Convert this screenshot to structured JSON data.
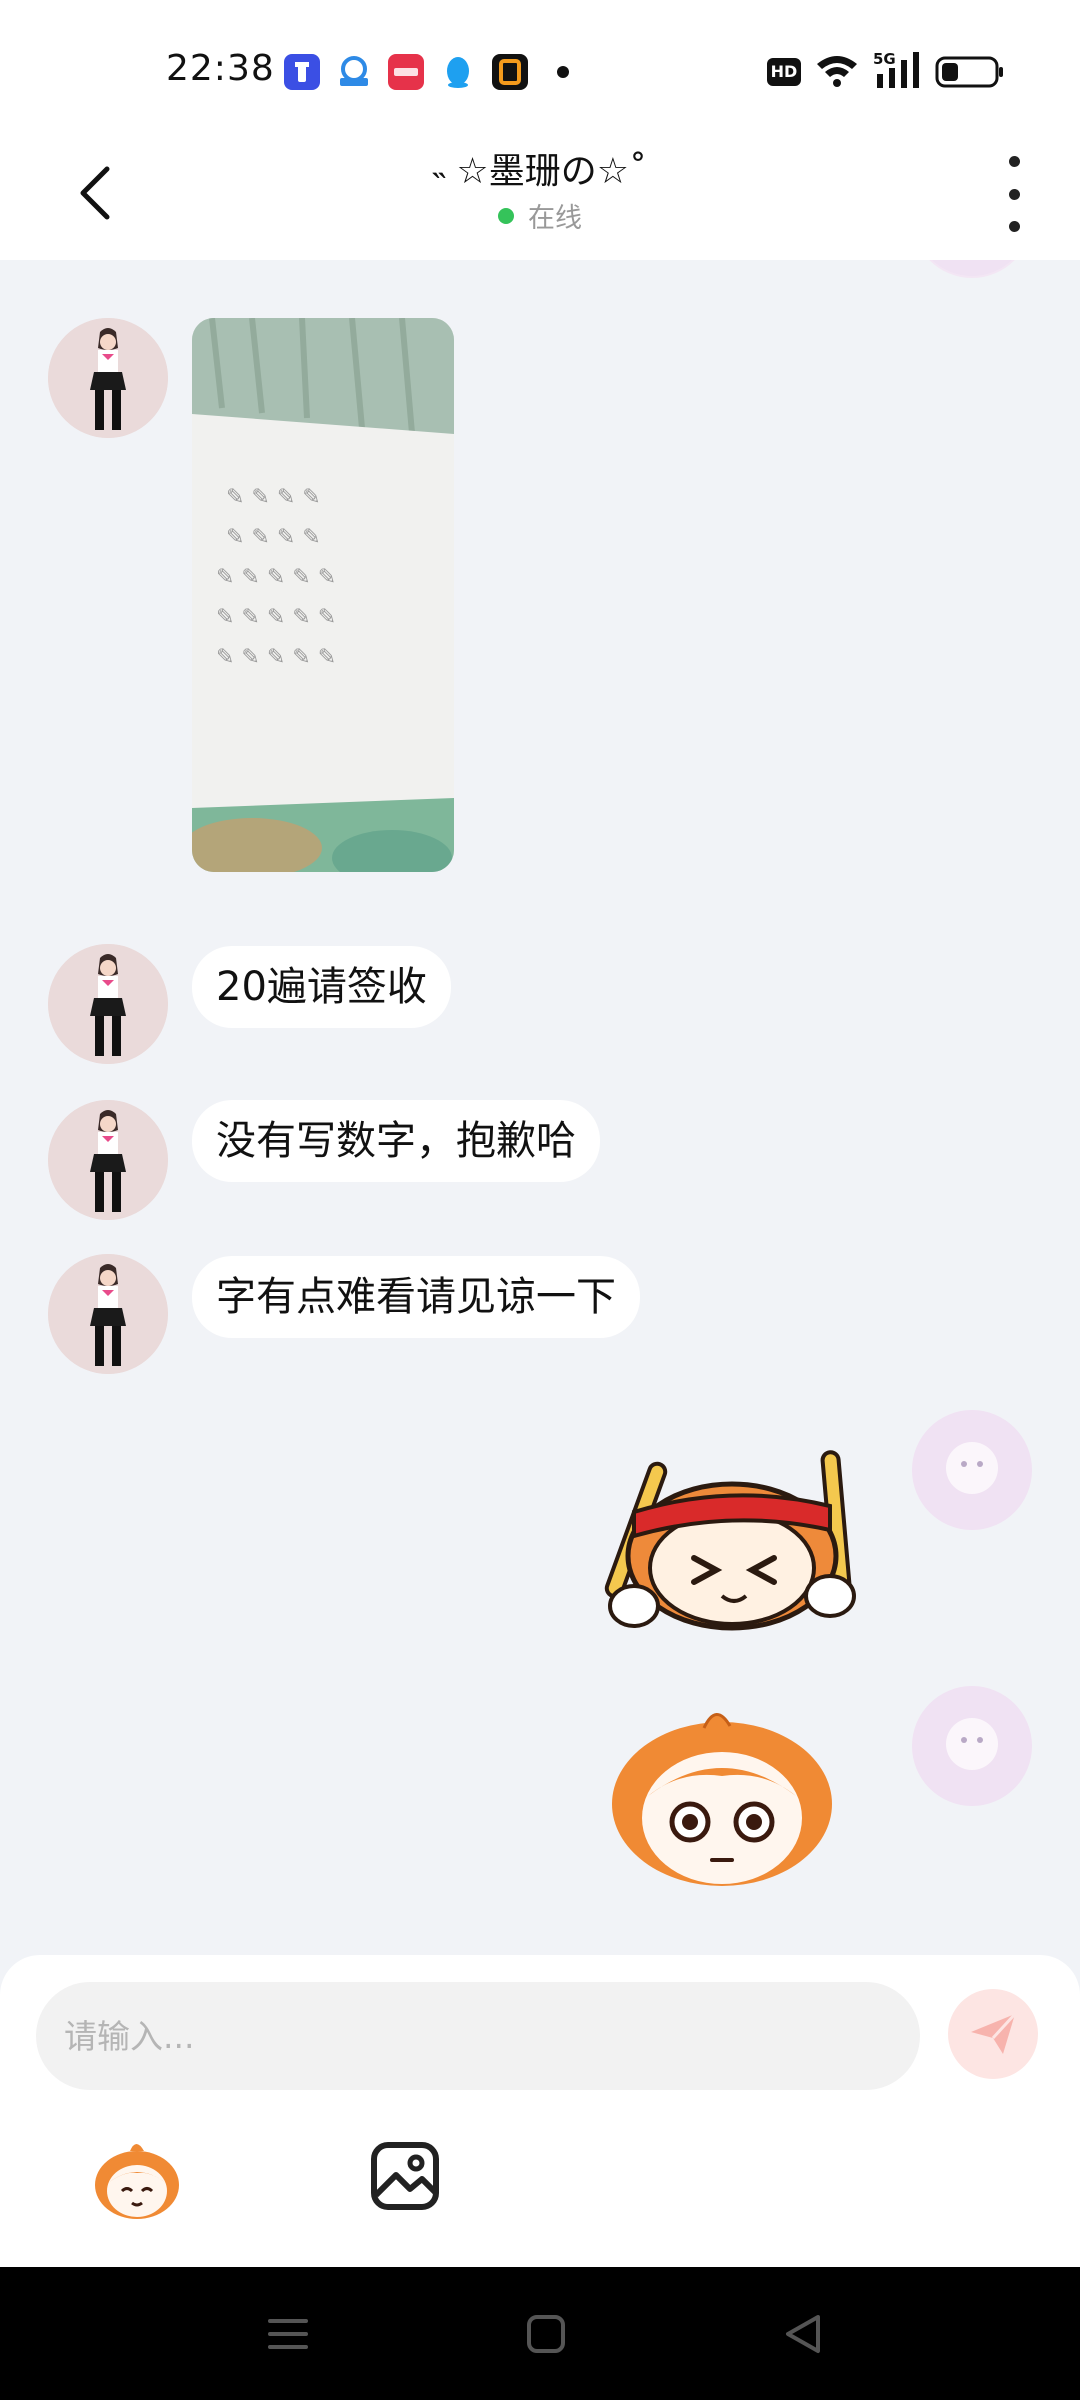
{
  "status_bar": {
    "time": "22:38",
    "hd_label": "HD",
    "network_label": "5G",
    "apps": [
      {
        "name": "app-icon-1",
        "color": "#3b4fe4"
      },
      {
        "name": "app-icon-2",
        "color": "#2e8ae6"
      },
      {
        "name": "app-icon-3",
        "color": "#e6324a"
      },
      {
        "name": "qq-icon",
        "color": "#1ea0f0"
      },
      {
        "name": "app-icon-5",
        "color": "#111111"
      }
    ]
  },
  "header": {
    "title": "˵ ☆墨珊の☆˚",
    "status": "在线",
    "status_color": "#35c35a"
  },
  "messages": [
    {
      "sender": "them",
      "type": "image",
      "image": "photo-of-handwritten-paper"
    },
    {
      "sender": "them",
      "type": "text",
      "text": "20遍请签收"
    },
    {
      "sender": "them",
      "type": "text",
      "text": "没有写数字，抱歉哈"
    },
    {
      "sender": "them",
      "type": "text",
      "text": "字有点难看请见谅一下"
    },
    {
      "sender": "me",
      "type": "sticker",
      "sticker": "drum-girl-sticker"
    },
    {
      "sender": "me",
      "type": "sticker",
      "sticker": "staring-girl-sticker"
    }
  ],
  "composer": {
    "placeholder": "请输入...",
    "send_icon": "send-icon",
    "tools": [
      "sticker-icon",
      "image-icon"
    ]
  },
  "colors": {
    "background": "#f1f3f7",
    "bubble": "#ffffff",
    "send_button": "#fde5e3",
    "send_arrow": "#f7b3ad"
  }
}
